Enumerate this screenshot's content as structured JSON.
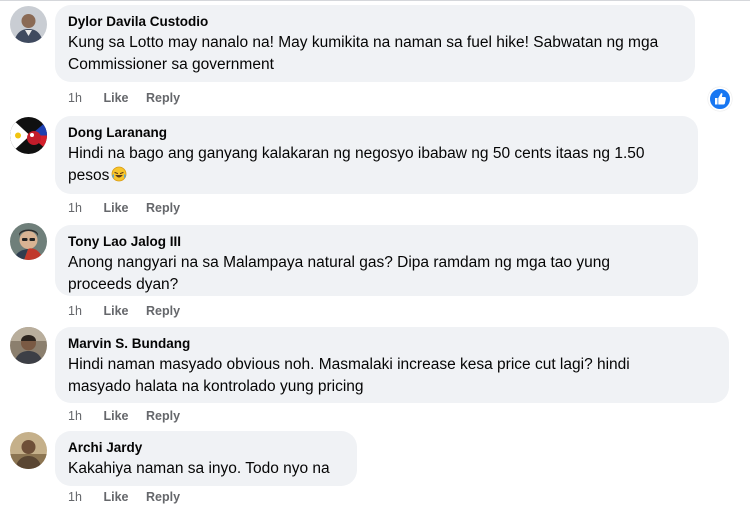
{
  "comments": [
    {
      "author": "Dylor Davila Custodio",
      "text": "Kung sa Lotto may nanalo na! May kumikita na naman sa fuel hike! Sabwatan ng mga\nCommissioner sa government",
      "time": "1h",
      "like_label": "Like",
      "reply_label": "Reply"
    },
    {
      "author": "Dong Laranang",
      "text": "Hindi na bago ang ganyang kalakaran ng negosyo ibabaw ng 50 cents itaas ng 1.50\npesos",
      "time": "1h",
      "like_label": "Like",
      "reply_label": "Reply"
    },
    {
      "author": "Tony Lao Jalog III",
      "text": "Anong nangyari na sa Malampaya natural gas? Dipa ramdam ng mga tao yung\nproceeds dyan?",
      "time": "1h",
      "like_label": "Like",
      "reply_label": "Reply"
    },
    {
      "author": "Marvin S. Bundang",
      "text": "Hindi naman masyado obvious noh. Masmalaki increase kesa price cut lagi? hindi\nmasyado halata na kontrolado yung pricing",
      "time": "1h",
      "like_label": "Like",
      "reply_label": "Reply"
    },
    {
      "author": "Archi Jardy",
      "text": "Kakahiya naman sa inyo. Todo nyo na",
      "time": "1h",
      "like_label": "Like",
      "reply_label": "Reply"
    }
  ],
  "reaction_icons": {
    "like_reaction": "thumbs-up-icon",
    "laughing_emoji": "laughing-emoji-icon"
  },
  "colors": {
    "bubble_background": "#f0f2f5",
    "meta_text": "#65676b",
    "like_blue": "#1877f2"
  }
}
